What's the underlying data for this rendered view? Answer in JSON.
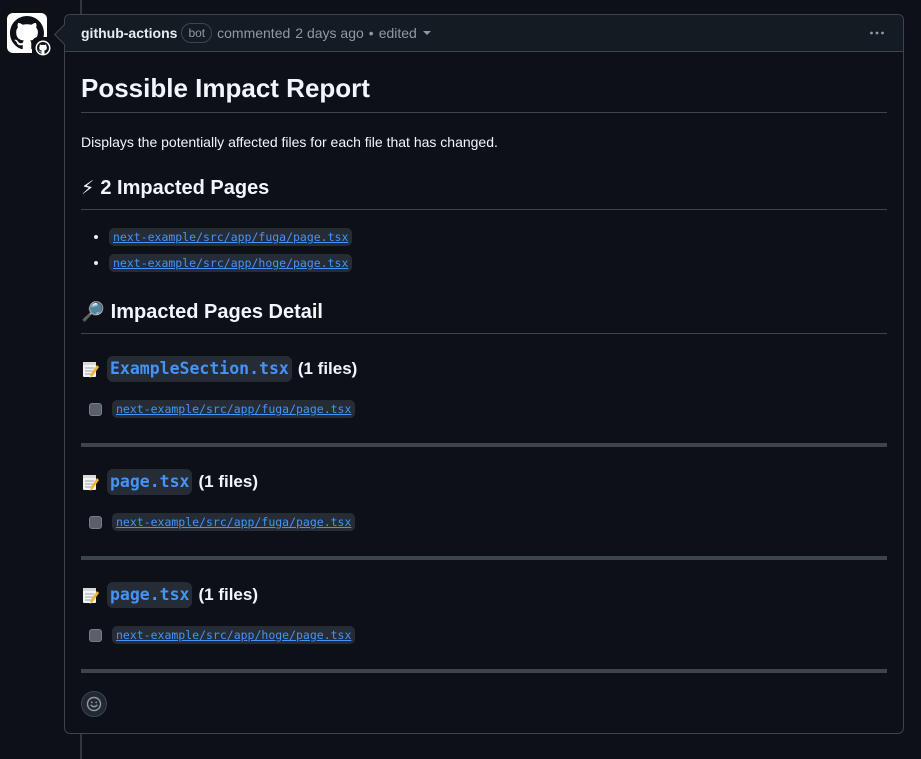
{
  "comment": {
    "author": "github-actions",
    "bot_badge": "bot",
    "action": "commented",
    "time": "2 days ago",
    "separator": "•",
    "edited": "edited"
  },
  "report": {
    "title": "Possible Impact Report",
    "description": "Displays the potentially affected files for each file that has changed.",
    "impacted_pages": {
      "emoji": "⚡",
      "heading": "2 Impacted Pages",
      "items": [
        "next-example/src/app/fuga/page.tsx",
        "next-example/src/app/hoge/page.tsx"
      ]
    },
    "detail": {
      "emoji": "🔎",
      "heading": "Impacted Pages Detail",
      "sections": [
        {
          "file": "ExampleSection.tsx",
          "count": "(1 files)",
          "items": [
            "next-example/src/app/fuga/page.tsx"
          ]
        },
        {
          "file": "page.tsx",
          "count": "(1 files)",
          "items": [
            "next-example/src/app/fuga/page.tsx"
          ]
        },
        {
          "file": "page.tsx",
          "count": "(1 files)",
          "items": [
            "next-example/src/app/hoge/page.tsx"
          ]
        }
      ]
    }
  },
  "icons": {
    "avatar": "github-octocat-icon",
    "badge": "github-actions-icon",
    "menu": "kebab-horizontal-icon",
    "section": "memo-icon",
    "reaction": "smiley-icon"
  },
  "colors": {
    "background": "#0d1117",
    "link": "#4493f8",
    "border": "#3d444d",
    "muted": "#9198a1"
  }
}
